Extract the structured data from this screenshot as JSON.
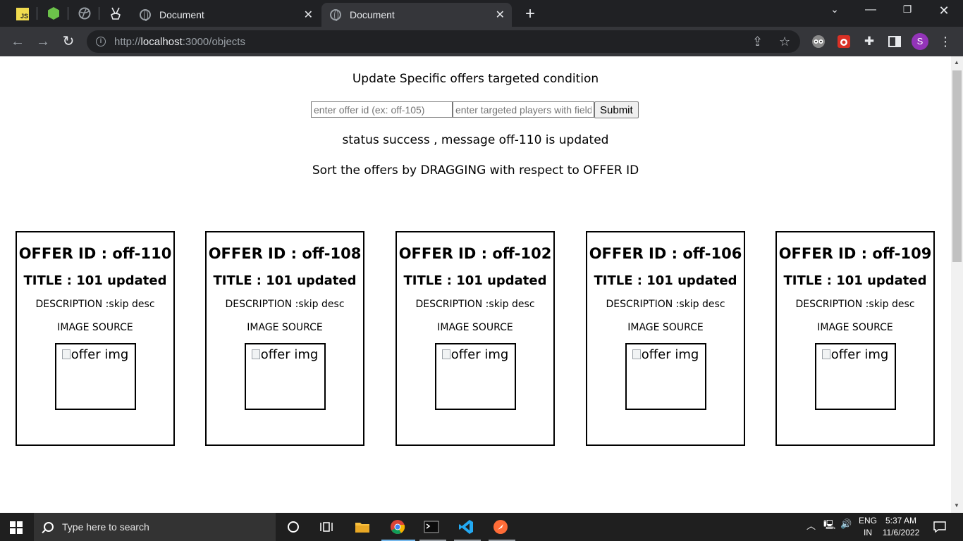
{
  "browser": {
    "tabs": [
      {
        "title": "Document",
        "active": false
      },
      {
        "title": "Document",
        "active": true
      }
    ],
    "pinned_tabs": [
      "js-icon",
      "nodejs-icon",
      "globe-icon",
      "puppeteer-icon"
    ],
    "url_scheme": "http://",
    "url_host": "localhost",
    "url_rest": ":3000/objects",
    "profile_initial": "S"
  },
  "page": {
    "heading": "Update Specific offers targeted condition",
    "form": {
      "offer_id_placeholder": "enter offer id (ex: off-105)",
      "targeted_placeholder": "enter targeted players with field",
      "submit_label": "Submit"
    },
    "status_message": "status success , message off-110 is updated",
    "sort_instruction": "Sort the offers by DRAGGING with respect to OFFER ID",
    "offers": [
      {
        "id_label": "OFFER ID : off-110",
        "title_label": "TITLE : 101 updated",
        "description_label": "DESCRIPTION :skip desc",
        "image_label": "IMAGE SOURCE",
        "img_alt": "offer img"
      },
      {
        "id_label": "OFFER ID : off-108",
        "title_label": "TITLE : 101 updated",
        "description_label": "DESCRIPTION :skip desc",
        "image_label": "IMAGE SOURCE",
        "img_alt": "offer img"
      },
      {
        "id_label": "OFFER ID : off-102",
        "title_label": "TITLE : 101 updated",
        "description_label": "DESCRIPTION :skip desc",
        "image_label": "IMAGE SOURCE",
        "img_alt": "offer img"
      },
      {
        "id_label": "OFFER ID : off-106",
        "title_label": "TITLE : 101 updated",
        "description_label": "DESCRIPTION :skip desc",
        "image_label": "IMAGE SOURCE",
        "img_alt": "offer img"
      },
      {
        "id_label": "OFFER ID : off-109",
        "title_label": "TITLE : 101 updated",
        "description_label": "DESCRIPTION :skip desc",
        "image_label": "IMAGE SOURCE",
        "img_alt": "offer img"
      }
    ]
  },
  "taskbar": {
    "search_placeholder": "Type here to search",
    "lang_top": "ENG",
    "lang_bottom": "IN",
    "time": "5:37 AM",
    "date": "11/6/2022"
  },
  "colors": {
    "chrome_dark": "#202124",
    "chrome_toolbar": "#35363a",
    "profile_purple": "#9334b8",
    "taskbar": "#1f1f1f"
  }
}
